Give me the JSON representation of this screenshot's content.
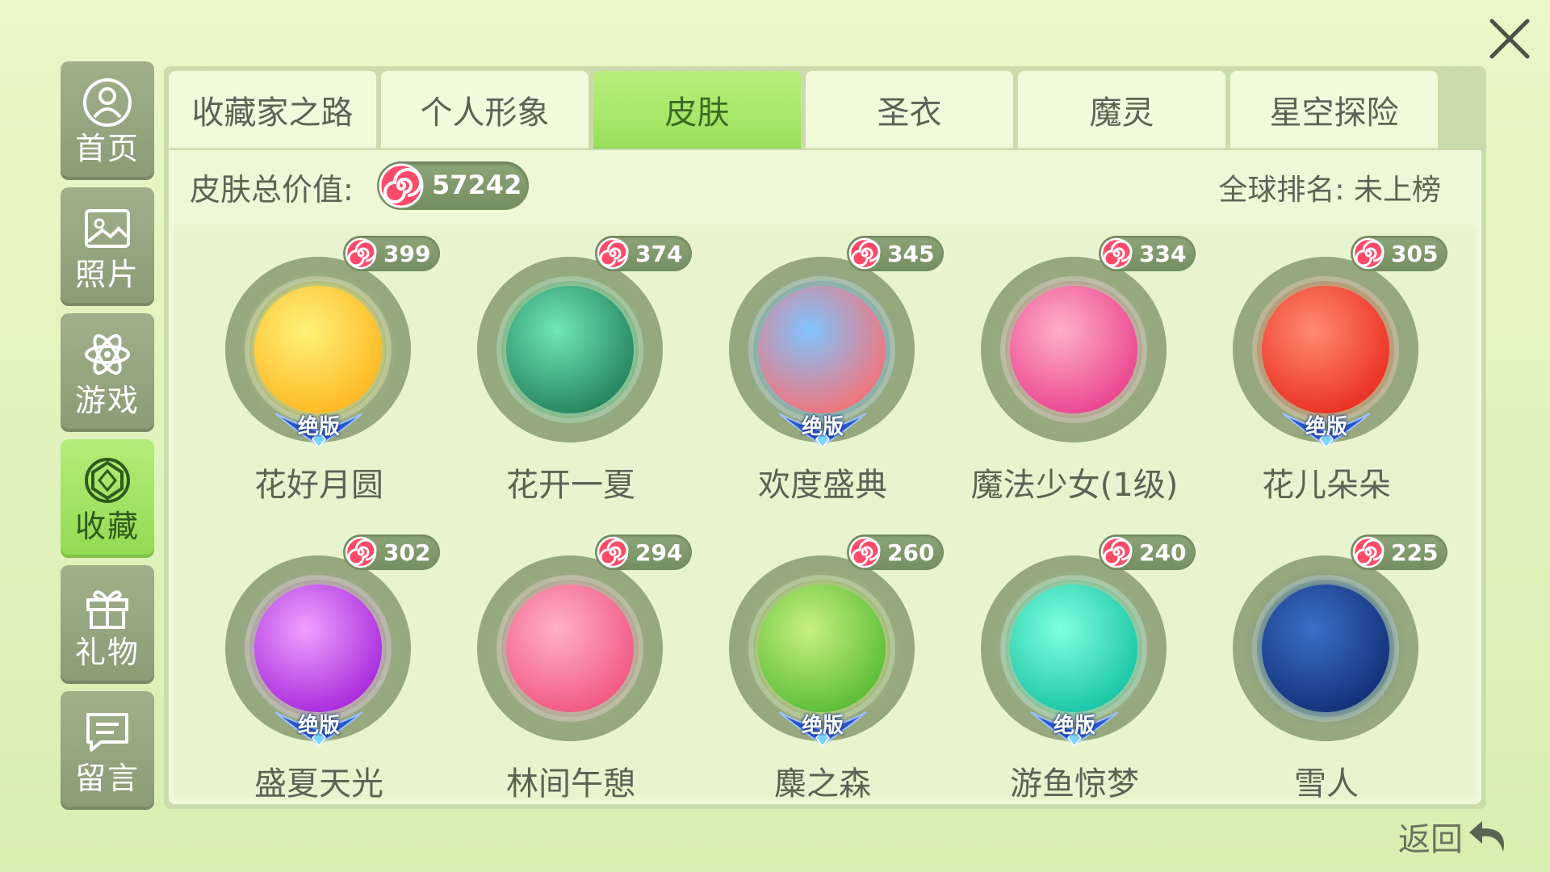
{
  "window": {
    "close_label": "close"
  },
  "sidebar": {
    "items": [
      {
        "label": "首页",
        "icon": "user-icon"
      },
      {
        "label": "照片",
        "icon": "photo-icon"
      },
      {
        "label": "游戏",
        "icon": "atom-icon"
      },
      {
        "label": "收藏",
        "icon": "gem-icon",
        "active": true
      },
      {
        "label": "礼物",
        "icon": "gift-icon"
      },
      {
        "label": "留言",
        "icon": "message-icon"
      }
    ]
  },
  "tabs": [
    {
      "label": "收藏家之路"
    },
    {
      "label": "个人形象"
    },
    {
      "label": "皮肤",
      "active": true
    },
    {
      "label": "圣衣"
    },
    {
      "label": "魔灵"
    },
    {
      "label": "星空探险"
    }
  ],
  "summary": {
    "label": "皮肤总价值:",
    "total": "57242",
    "rank": "全球排名: 未上榜"
  },
  "skins": [
    {
      "name": "花好月圆",
      "price": "399",
      "badge": "绝版",
      "colors": [
        "#fff27a",
        "#ffb31a"
      ]
    },
    {
      "name": "花开一夏",
      "price": "374",
      "badge": "",
      "colors": [
        "#6ee8b4",
        "#1f7a55"
      ]
    },
    {
      "name": "欢度盛典",
      "price": "345",
      "badge": "绝版",
      "colors": [
        "#7fc4ff",
        "#ff6b6b"
      ]
    },
    {
      "name": "魔法少女(1级)",
      "price": "334",
      "badge": "",
      "colors": [
        "#ffb0c8",
        "#e83a8a"
      ]
    },
    {
      "name": "花儿朵朵",
      "price": "305",
      "badge": "绝版",
      "colors": [
        "#ff8a70",
        "#e8281a"
      ]
    },
    {
      "name": "盛夏天光",
      "price": "302",
      "badge": "绝版",
      "colors": [
        "#f0a0ff",
        "#a020d8"
      ]
    },
    {
      "name": "林间午憩",
      "price": "294",
      "badge": "",
      "colors": [
        "#ffb0c8",
        "#f0507a"
      ]
    },
    {
      "name": "麋之森",
      "price": "260",
      "badge": "绝版",
      "colors": [
        "#c8f080",
        "#50b830"
      ]
    },
    {
      "name": "游鱼惊梦",
      "price": "240",
      "badge": "绝版",
      "colors": [
        "#80ffe0",
        "#10c0a0"
      ]
    },
    {
      "name": "雪人",
      "price": "225",
      "badge": "",
      "colors": [
        "#3a70c8",
        "#102a70"
      ]
    }
  ],
  "footer": {
    "back_label": "返回"
  },
  "colors": {
    "accent_green": "#9ae05b",
    "sidebar_gray": "#8a9c76",
    "text": "#5b6454"
  }
}
